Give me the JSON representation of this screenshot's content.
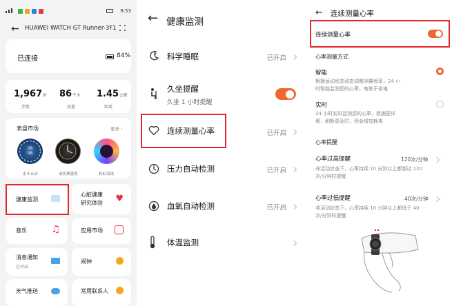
{
  "left": {
    "status_time": "9:53",
    "title": "HUAWEI WATCH GT Runner-3F1",
    "connection": {
      "label": "已连接",
      "battery": "84%"
    },
    "stats": [
      {
        "value": "1,967",
        "unit": "步",
        "caption": "步数"
      },
      {
        "value": "86",
        "unit": "千卡",
        "caption": "热量"
      },
      {
        "value": "1.45",
        "unit": "公里",
        "caption": "距离"
      }
    ],
    "dials": {
      "header": "表盘市场",
      "more": "更多",
      "items": [
        {
          "caption": "永不止步"
        },
        {
          "caption": "商务质感表"
        },
        {
          "caption": "彩虹流线"
        }
      ]
    },
    "tiles": {
      "health": "健康监测",
      "heart_l1": "心脏健康",
      "heart_l2": "研究体验",
      "music": "音乐",
      "appmarket": "应用市场",
      "msg_l1": "消息通知",
      "msg_sub": "已开启",
      "alarm": "闹钟",
      "weather": "天气推送",
      "contacts": "常用联系人"
    }
  },
  "middle": {
    "title": "健康监测",
    "rows": [
      {
        "title": "科学睡眠",
        "status": "已开启"
      },
      {
        "title": "久坐提醒",
        "sub": "久坐 1 小时提醒"
      },
      {
        "title": "连续测量心率",
        "status": "已开启"
      },
      {
        "title": "压力自动检测",
        "status": "已开启"
      },
      {
        "title": "血氧自动检测",
        "status": "已开启"
      },
      {
        "title": "体温监测",
        "status": ""
      }
    ]
  },
  "right": {
    "title": "连续测量心率",
    "toggle_label": "连续测量心率",
    "method_header": "心率测量方式",
    "smart": {
      "title": "智能",
      "desc1": "根据运动状态动态调整测量频率，24 小",
      "desc2": "时智能监测您的心率，有助于省电"
    },
    "realtime": {
      "title": "实时",
      "desc1": "24 小时实时监测您的心率，数据更详",
      "desc2": "细，刷新更及时，但会增加耗电"
    },
    "alert_header": "心率提醒",
    "high": {
      "title": "心率过高提醒",
      "value": "120次/分钟",
      "desc1": "非活动状态下，心率持续 10 分钟以上都超过 120",
      "desc2": "次/分钟时提醒"
    },
    "low": {
      "title": "心率过低提醒",
      "value": "40次/分钟",
      "desc1": "非活动状态下，心率持续 10 分钟以上都低于 40",
      "desc2": "次/分钟时提醒"
    }
  },
  "colors": {
    "accent": "#f0672d",
    "highlight": "#e3262a",
    "heart": "#e8304a",
    "blue_tile": "#4aa3e8"
  }
}
